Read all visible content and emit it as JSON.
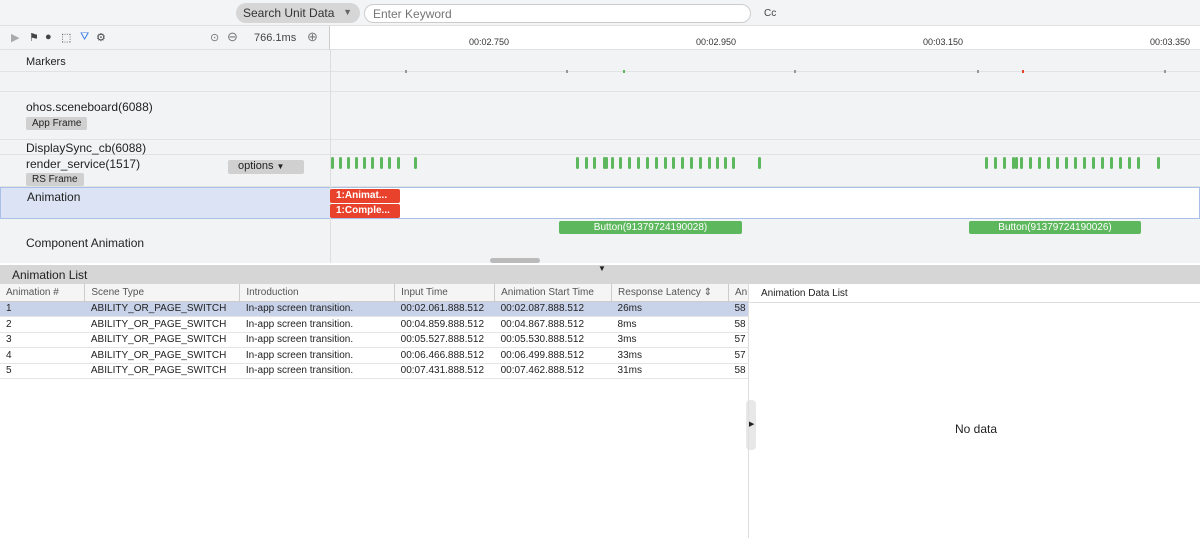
{
  "search": {
    "type_label": "Search Unit Data",
    "placeholder": "Enter Keyword",
    "case_label": "Cc"
  },
  "toolbar": {
    "zoom_value": "766.1ms"
  },
  "ruler": {
    "ticks": [
      "00:02.750",
      "00:02.950",
      "00:03.150",
      "00:03.350"
    ]
  },
  "lanes": {
    "markers": "Markers",
    "sceneboard": "ohos.sceneboard(6088)",
    "app_frame": "App Frame",
    "displaysync": "DisplaySync_cb(6088)",
    "render_service": "render_service(1517)",
    "rs_frame": "RS Frame",
    "options": "options",
    "animation": "Animation",
    "anim_slice1": "1:Animat...",
    "anim_slice2": "1:Comple...",
    "component_animation": "Component Animation",
    "button1": "Button(91379724190028)",
    "button2": "Button(91379724190026)"
  },
  "colors": {
    "green": "#5db85d",
    "red": "#e8412c",
    "selected": "#dbe3f4"
  },
  "panel": {
    "title": "Animation List",
    "columns": [
      "Animation #",
      "Scene Type",
      "Introduction",
      "Input Time",
      "Animation Start Time",
      "Response Latency ⇕",
      "An"
    ],
    "rows": [
      [
        "1",
        "ABILITY_OR_PAGE_SWITCH",
        "In-app screen transition.",
        "00:02.061.888.512",
        "00:02.087.888.512",
        "26ms",
        "58"
      ],
      [
        "2",
        "ABILITY_OR_PAGE_SWITCH",
        "In-app screen transition.",
        "00:04.859.888.512",
        "00:04.867.888.512",
        "8ms",
        "58"
      ],
      [
        "3",
        "ABILITY_OR_PAGE_SWITCH",
        "In-app screen transition.",
        "00:05.527.888.512",
        "00:05.530.888.512",
        "3ms",
        "57"
      ],
      [
        "4",
        "ABILITY_OR_PAGE_SWITCH",
        "In-app screen transition.",
        "00:06.466.888.512",
        "00:06.499.888.512",
        "33ms",
        "57"
      ],
      [
        "5",
        "ABILITY_OR_PAGE_SWITCH",
        "In-app screen transition.",
        "00:07.431.888.512",
        "00:07.462.888.512",
        "31ms",
        "58"
      ]
    ],
    "data_list_title": "Animation Data List",
    "no_data": "No data"
  }
}
